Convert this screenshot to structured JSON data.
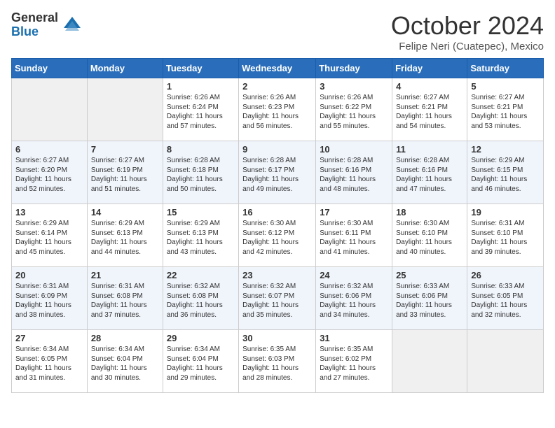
{
  "logo": {
    "general": "General",
    "blue": "Blue"
  },
  "title": "October 2024",
  "location": "Felipe Neri (Cuatepec), Mexico",
  "days_of_week": [
    "Sunday",
    "Monday",
    "Tuesday",
    "Wednesday",
    "Thursday",
    "Friday",
    "Saturday"
  ],
  "weeks": [
    [
      {
        "day": "",
        "info": ""
      },
      {
        "day": "",
        "info": ""
      },
      {
        "day": "1",
        "info": "Sunrise: 6:26 AM\nSunset: 6:24 PM\nDaylight: 11 hours and 57 minutes."
      },
      {
        "day": "2",
        "info": "Sunrise: 6:26 AM\nSunset: 6:23 PM\nDaylight: 11 hours and 56 minutes."
      },
      {
        "day": "3",
        "info": "Sunrise: 6:26 AM\nSunset: 6:22 PM\nDaylight: 11 hours and 55 minutes."
      },
      {
        "day": "4",
        "info": "Sunrise: 6:27 AM\nSunset: 6:21 PM\nDaylight: 11 hours and 54 minutes."
      },
      {
        "day": "5",
        "info": "Sunrise: 6:27 AM\nSunset: 6:21 PM\nDaylight: 11 hours and 53 minutes."
      }
    ],
    [
      {
        "day": "6",
        "info": "Sunrise: 6:27 AM\nSunset: 6:20 PM\nDaylight: 11 hours and 52 minutes."
      },
      {
        "day": "7",
        "info": "Sunrise: 6:27 AM\nSunset: 6:19 PM\nDaylight: 11 hours and 51 minutes."
      },
      {
        "day": "8",
        "info": "Sunrise: 6:28 AM\nSunset: 6:18 PM\nDaylight: 11 hours and 50 minutes."
      },
      {
        "day": "9",
        "info": "Sunrise: 6:28 AM\nSunset: 6:17 PM\nDaylight: 11 hours and 49 minutes."
      },
      {
        "day": "10",
        "info": "Sunrise: 6:28 AM\nSunset: 6:16 PM\nDaylight: 11 hours and 48 minutes."
      },
      {
        "day": "11",
        "info": "Sunrise: 6:28 AM\nSunset: 6:16 PM\nDaylight: 11 hours and 47 minutes."
      },
      {
        "day": "12",
        "info": "Sunrise: 6:29 AM\nSunset: 6:15 PM\nDaylight: 11 hours and 46 minutes."
      }
    ],
    [
      {
        "day": "13",
        "info": "Sunrise: 6:29 AM\nSunset: 6:14 PM\nDaylight: 11 hours and 45 minutes."
      },
      {
        "day": "14",
        "info": "Sunrise: 6:29 AM\nSunset: 6:13 PM\nDaylight: 11 hours and 44 minutes."
      },
      {
        "day": "15",
        "info": "Sunrise: 6:29 AM\nSunset: 6:13 PM\nDaylight: 11 hours and 43 minutes."
      },
      {
        "day": "16",
        "info": "Sunrise: 6:30 AM\nSunset: 6:12 PM\nDaylight: 11 hours and 42 minutes."
      },
      {
        "day": "17",
        "info": "Sunrise: 6:30 AM\nSunset: 6:11 PM\nDaylight: 11 hours and 41 minutes."
      },
      {
        "day": "18",
        "info": "Sunrise: 6:30 AM\nSunset: 6:10 PM\nDaylight: 11 hours and 40 minutes."
      },
      {
        "day": "19",
        "info": "Sunrise: 6:31 AM\nSunset: 6:10 PM\nDaylight: 11 hours and 39 minutes."
      }
    ],
    [
      {
        "day": "20",
        "info": "Sunrise: 6:31 AM\nSunset: 6:09 PM\nDaylight: 11 hours and 38 minutes."
      },
      {
        "day": "21",
        "info": "Sunrise: 6:31 AM\nSunset: 6:08 PM\nDaylight: 11 hours and 37 minutes."
      },
      {
        "day": "22",
        "info": "Sunrise: 6:32 AM\nSunset: 6:08 PM\nDaylight: 11 hours and 36 minutes."
      },
      {
        "day": "23",
        "info": "Sunrise: 6:32 AM\nSunset: 6:07 PM\nDaylight: 11 hours and 35 minutes."
      },
      {
        "day": "24",
        "info": "Sunrise: 6:32 AM\nSunset: 6:06 PM\nDaylight: 11 hours and 34 minutes."
      },
      {
        "day": "25",
        "info": "Sunrise: 6:33 AM\nSunset: 6:06 PM\nDaylight: 11 hours and 33 minutes."
      },
      {
        "day": "26",
        "info": "Sunrise: 6:33 AM\nSunset: 6:05 PM\nDaylight: 11 hours and 32 minutes."
      }
    ],
    [
      {
        "day": "27",
        "info": "Sunrise: 6:34 AM\nSunset: 6:05 PM\nDaylight: 11 hours and 31 minutes."
      },
      {
        "day": "28",
        "info": "Sunrise: 6:34 AM\nSunset: 6:04 PM\nDaylight: 11 hours and 30 minutes."
      },
      {
        "day": "29",
        "info": "Sunrise: 6:34 AM\nSunset: 6:04 PM\nDaylight: 11 hours and 29 minutes."
      },
      {
        "day": "30",
        "info": "Sunrise: 6:35 AM\nSunset: 6:03 PM\nDaylight: 11 hours and 28 minutes."
      },
      {
        "day": "31",
        "info": "Sunrise: 6:35 AM\nSunset: 6:02 PM\nDaylight: 11 hours and 27 minutes."
      },
      {
        "day": "",
        "info": ""
      },
      {
        "day": "",
        "info": ""
      }
    ]
  ]
}
